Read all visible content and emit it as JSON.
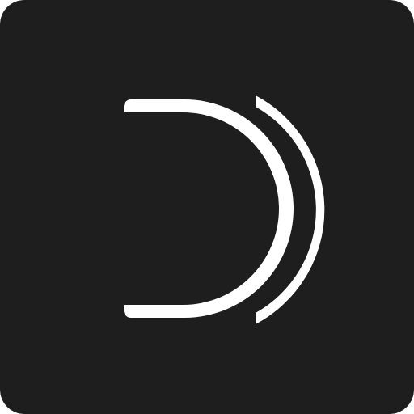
{
  "icon": {
    "name": "d-logo-icon",
    "background_color": "#1e1e1e",
    "foreground_color": "#ffffff"
  }
}
